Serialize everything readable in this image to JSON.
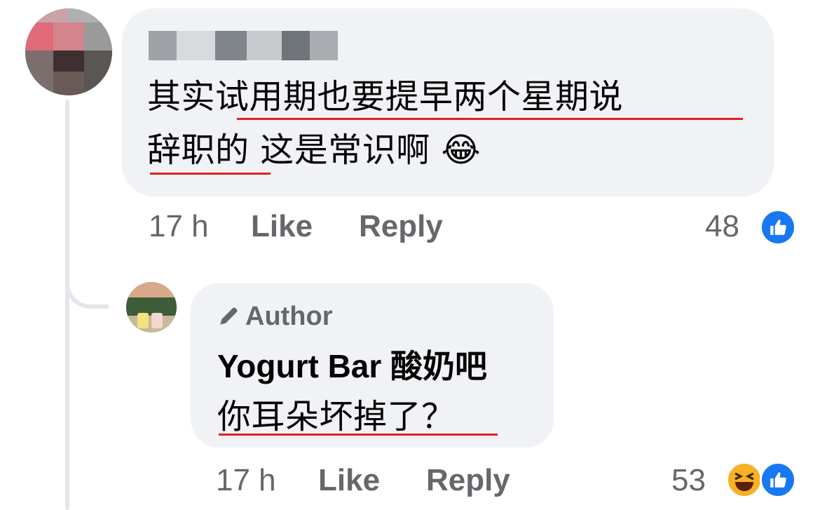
{
  "comment1": {
    "author_name": "",
    "line1": "其实试用期也要提早两个星期说",
    "line2": "辞职的 这是常识啊 😂",
    "emoji_icon": "tears-of-joy-icon",
    "time": "17 h",
    "like_label": "Like",
    "reply_label": "Reply",
    "reaction_count": "48",
    "reaction_icons": [
      "like-icon"
    ]
  },
  "reply1": {
    "badge_label": "Author",
    "badge_icon": "pencil-icon",
    "author_name": "Yogurt Bar 酸奶吧",
    "line1": "你耳朵坏掉了？",
    "time": "17 h",
    "like_label": "Like",
    "reply_label": "Reply",
    "reaction_count": "53",
    "reaction_icons": [
      "haha-icon",
      "like-icon"
    ]
  },
  "colors": {
    "bubble": "#f0f2f5",
    "meta_text": "#65676b",
    "like_blue": "#1877f2",
    "underline_red": "#e02020",
    "thread_line": "#e4e6eb"
  }
}
